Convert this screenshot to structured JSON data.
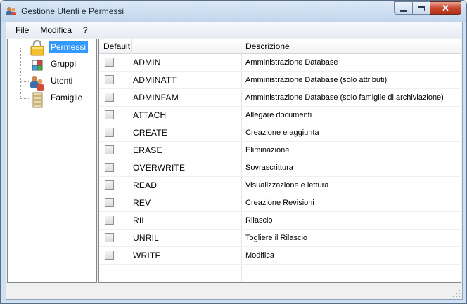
{
  "window": {
    "title": "Gestione Utenti e Permessi",
    "close_symbol": "✕"
  },
  "menu": [
    "File",
    "Modifica",
    "?"
  ],
  "tree": {
    "items": [
      {
        "label": "Permessi",
        "icon": "lock-icon",
        "selected": true
      },
      {
        "label": "Gruppi",
        "icon": "groups-icon",
        "selected": false
      },
      {
        "label": "Utenti",
        "icon": "users-icon",
        "selected": false
      },
      {
        "label": "Famiglie",
        "icon": "families-icon",
        "selected": false
      }
    ]
  },
  "grid": {
    "headers": {
      "default": "Default",
      "code": "",
      "description": "Descrizione"
    },
    "rows": [
      {
        "code": "ADMIN",
        "description": "Amministrazione Database",
        "checked": false
      },
      {
        "code": "ADMINATT",
        "description": "Amministrazione Database (solo attributi)",
        "checked": false
      },
      {
        "code": "ADMINFAM",
        "description": "Amministrazione Database (solo famiglie di archiviazione)",
        "checked": false
      },
      {
        "code": "ATTACH",
        "description": "Allegare documenti",
        "checked": false
      },
      {
        "code": "CREATE",
        "description": "Creazione e aggiunta",
        "checked": false
      },
      {
        "code": "ERASE",
        "description": "Eliminazione",
        "checked": false
      },
      {
        "code": "OVERWRITE",
        "description": "Sovrascrittura",
        "checked": false
      },
      {
        "code": "READ",
        "description": "Visualizzazione e lettura",
        "checked": false
      },
      {
        "code": "REV",
        "description": "Creazione Revisioni",
        "checked": false
      },
      {
        "code": "RIL",
        "description": "Rilascio",
        "checked": false
      },
      {
        "code": "UNRIL",
        "description": "Togliere il Rilascio",
        "checked": false
      },
      {
        "code": "WRITE",
        "description": "Modifica",
        "checked": false
      }
    ]
  },
  "colors": {
    "selection": "#3399ff",
    "titlebar": "#c2d6ec",
    "close_button": "#c8462c"
  }
}
